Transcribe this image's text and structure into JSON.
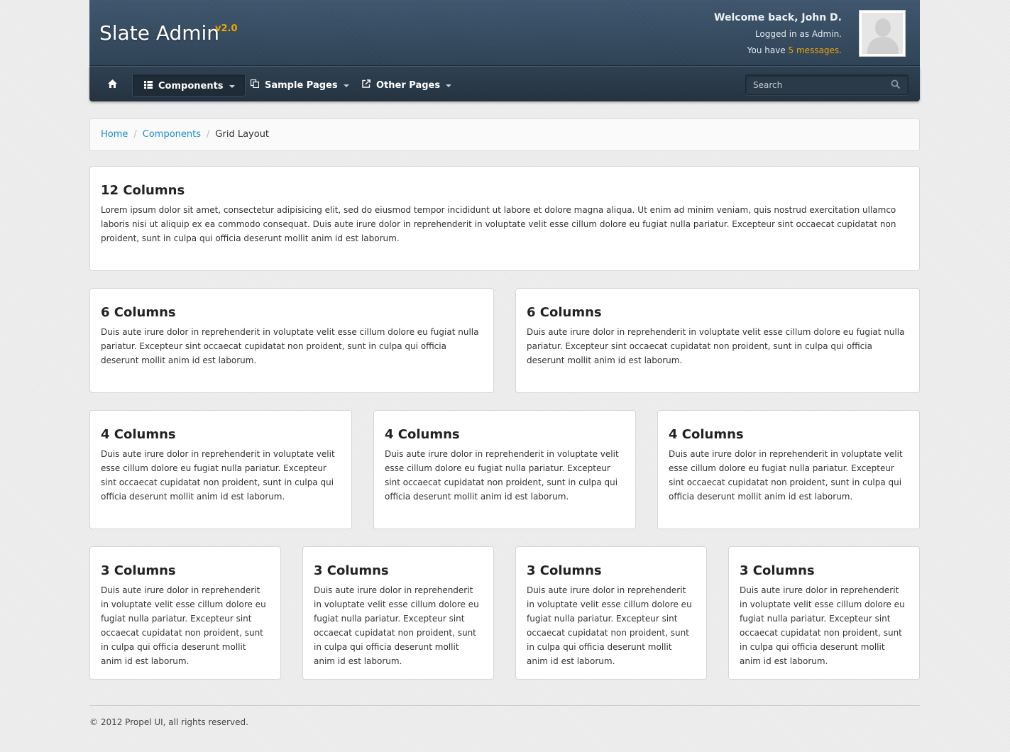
{
  "header": {
    "brand": "Slate Admin",
    "version": "v2.0",
    "welcome": "Welcome back, John D.",
    "logged_in": "Logged in as Admin.",
    "messages_prefix": "You have ",
    "messages_link": "5 messages."
  },
  "nav": {
    "home_icon": "home-icon",
    "items": [
      {
        "label": "Components",
        "icon": "grid-icon"
      },
      {
        "label": "Sample Pages",
        "icon": "copy-icon"
      },
      {
        "label": "Other Pages",
        "icon": "external-link-icon"
      }
    ],
    "search_placeholder": "Search"
  },
  "breadcrumb": {
    "home": "Home",
    "components": "Components",
    "current": "Grid Layout"
  },
  "panels": {
    "row12": {
      "title": "12 Columns",
      "text": "Lorem ipsum dolor sit amet, consectetur adipisicing elit, sed do eiusmod tempor incididunt ut labore et dolore magna aliqua. Ut enim ad minim veniam, quis nostrud exercitation ullamco laboris nisi ut aliquip ex ea commodo consequat. Duis aute irure dolor in reprehenderit in voluptate velit esse cillum dolore eu fugiat nulla pariatur. Excepteur sint occaecat cupidatat non proident, sunt in culpa qui officia deserunt mollit anim id est laborum."
    },
    "six_title": "6 Columns",
    "four_title": "4 Columns",
    "three_title": "3 Columns",
    "short_text": "Duis aute irure dolor in reprehenderit in voluptate velit esse cillum dolore eu fugiat nulla pariatur. Excepteur sint occaecat cupidatat non proident, sunt in culpa qui officia deserunt mollit anim id est laborum."
  },
  "footer": {
    "copyright": "© 2012 Propel UI, all rights reserved."
  }
}
